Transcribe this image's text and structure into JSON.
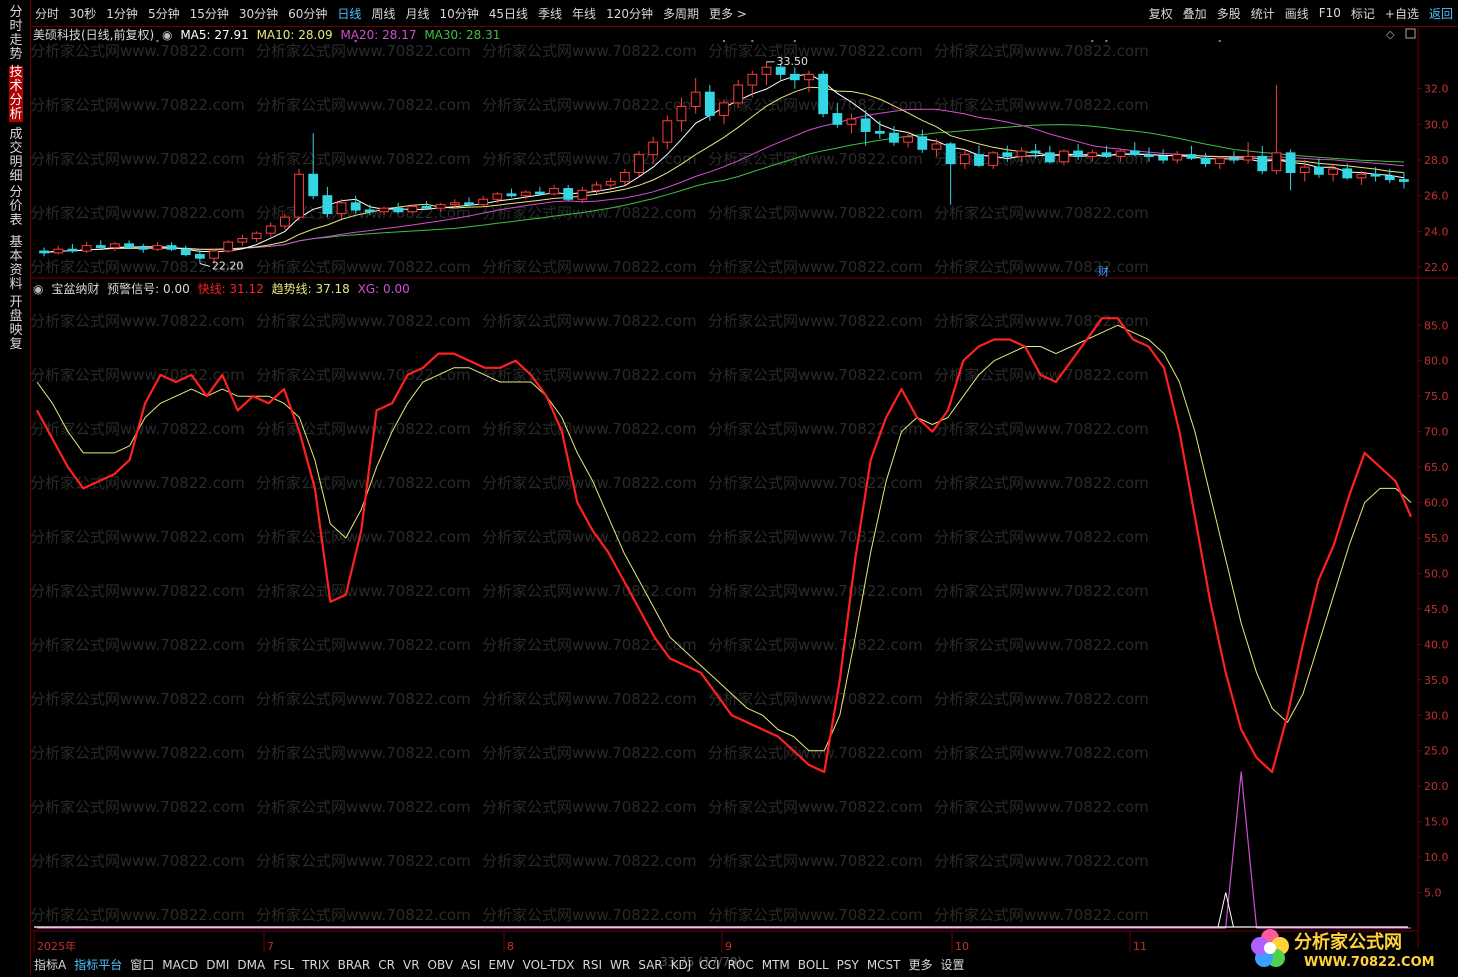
{
  "app": {
    "topbar_periods": [
      "分时",
      "30秒",
      "1分钟",
      "5分钟",
      "15分钟",
      "30分钟",
      "60分钟",
      "日线",
      "周线",
      "月线",
      "10分钟",
      "45日线",
      "季线",
      "年线",
      "120分钟",
      "多周期",
      "更多 >"
    ],
    "topbar_active": "日线",
    "topbar_right": [
      "复权",
      "叠加",
      "多股",
      "统计",
      "画线",
      "F10",
      "标记",
      "+自选",
      "返回"
    ],
    "sidebar": [
      "分时走势",
      "技术分析",
      "成交明细",
      "分价表",
      "基本资料",
      "开盘映复"
    ],
    "sidebar_active": "技术分析"
  },
  "main_chart": {
    "stock_title": "美硕科技(日线,前复权)",
    "ma5_label": "MA5: 27.91",
    "ma10_label": "MA10: 28.09",
    "ma20_label": "MA20: 28.17",
    "ma30_label": "MA30: 28.31",
    "high_label": "33.50",
    "low_label": "22.20",
    "cai_marker": "财",
    "price_axis": [
      "32.0",
      "30.0",
      "28.0",
      "26.0",
      "24.0",
      "22.0"
    ]
  },
  "indicator": {
    "name": "宝盆纳财",
    "signal_label": "预警信号: 0.00",
    "fast_label": "快线: 31.12",
    "trend_label": "趋势线: 37.18",
    "xg_label": "XG: 0.00",
    "axis": [
      "85.0",
      "80.0",
      "75.0",
      "70.0",
      "65.0",
      "60.0",
      "55.0",
      "50.0",
      "45.0",
      "40.0",
      "35.0",
      "30.0",
      "25.0",
      "20.0",
      "15.0",
      "10.0",
      "5.0"
    ]
  },
  "date_axis": [
    "2025年",
    "7",
    "8",
    "9",
    "10",
    "11"
  ],
  "watermark": "分析家公式网www.70822.com",
  "cursor_label": "33.75 (17/79)",
  "bottom_tabs": [
    "指标A",
    "指标平台",
    "窗口",
    "MACD",
    "DMI",
    "DMA",
    "FSL",
    "TRIX",
    "BRAR",
    "CR",
    "VR",
    "OBV",
    "ASI",
    "EMV",
    "VOL-TDX",
    "RSI",
    "WR",
    "SAR",
    "KDJ",
    "CCI",
    "ROC",
    "MTM",
    "BOLL",
    "PSY",
    "MCST",
    "更多",
    "设置"
  ],
  "bottom_active": "指标平台",
  "logo": {
    "line1": "分析家公式网",
    "line2": "WWW.70822.COM"
  },
  "colors": {
    "up": "#ff3b3b",
    "down": "#35d6e4",
    "fast": "#ff2020",
    "trend": "#e8e880",
    "ma5": "#ffffff",
    "ma10": "#e8e880",
    "ma20": "#d050d0",
    "ma30": "#40c040",
    "border": "#6e0000"
  },
  "chart_data": [
    {
      "type": "candlestick",
      "title": "美硕科技(日线,前复权)",
      "ylim": [
        21.5,
        34.5
      ],
      "candles_ohlc": [
        [
          22.9,
          23.1,
          22.6,
          22.8
        ],
        [
          22.8,
          23.2,
          22.7,
          23.0
        ],
        [
          23.0,
          23.3,
          22.8,
          22.9
        ],
        [
          22.9,
          23.4,
          22.8,
          23.2
        ],
        [
          23.2,
          23.5,
          23.0,
          23.1
        ],
        [
          23.1,
          23.4,
          22.9,
          23.3
        ],
        [
          23.3,
          23.5,
          23.0,
          23.1
        ],
        [
          23.1,
          23.3,
          22.8,
          23.0
        ],
        [
          23.0,
          23.4,
          22.9,
          23.2
        ],
        [
          23.2,
          23.4,
          22.9,
          23.0
        ],
        [
          23.0,
          23.2,
          22.6,
          22.7
        ],
        [
          22.7,
          23.0,
          22.2,
          22.5
        ],
        [
          22.5,
          23.0,
          22.2,
          22.9
        ],
        [
          22.9,
          23.5,
          22.8,
          23.4
        ],
        [
          23.4,
          23.8,
          23.2,
          23.6
        ],
        [
          23.6,
          24.0,
          23.4,
          23.9
        ],
        [
          23.9,
          24.5,
          23.7,
          24.3
        ],
        [
          24.3,
          25.0,
          24.1,
          24.8
        ],
        [
          24.8,
          27.5,
          24.6,
          27.2
        ],
        [
          27.2,
          29.5,
          25.8,
          26.0
        ],
        [
          26.0,
          26.5,
          24.8,
          25.0
        ],
        [
          25.0,
          25.8,
          24.7,
          25.6
        ],
        [
          25.6,
          26.0,
          25.0,
          25.2
        ],
        [
          25.2,
          25.5,
          24.9,
          25.1
        ],
        [
          25.1,
          25.4,
          24.9,
          25.3
        ],
        [
          25.3,
          25.6,
          25.0,
          25.1
        ],
        [
          25.1,
          25.5,
          25.0,
          25.4
        ],
        [
          25.4,
          25.7,
          25.2,
          25.3
        ],
        [
          25.3,
          25.6,
          25.1,
          25.5
        ],
        [
          25.5,
          25.8,
          25.3,
          25.6
        ],
        [
          25.6,
          25.9,
          25.4,
          25.5
        ],
        [
          25.5,
          26.0,
          25.4,
          25.8
        ],
        [
          25.8,
          26.2,
          25.6,
          26.1
        ],
        [
          26.1,
          26.4,
          25.9,
          26.0
        ],
        [
          26.0,
          26.3,
          25.8,
          26.2
        ],
        [
          26.2,
          26.5,
          26.0,
          26.1
        ],
        [
          26.1,
          26.6,
          26.0,
          26.4
        ],
        [
          26.4,
          26.6,
          25.7,
          25.8
        ],
        [
          25.8,
          26.5,
          25.6,
          26.3
        ],
        [
          26.3,
          26.8,
          26.1,
          26.6
        ],
        [
          26.6,
          27.0,
          26.3,
          26.8
        ],
        [
          26.8,
          27.5,
          26.6,
          27.3
        ],
        [
          27.3,
          28.5,
          27.1,
          28.3
        ],
        [
          28.3,
          29.3,
          27.8,
          29.0
        ],
        [
          29.0,
          30.5,
          28.6,
          30.2
        ],
        [
          30.2,
          31.5,
          29.6,
          31.0
        ],
        [
          31.0,
          32.6,
          30.6,
          31.8
        ],
        [
          31.8,
          32.2,
          30.2,
          30.5
        ],
        [
          30.5,
          31.4,
          30.0,
          31.2
        ],
        [
          31.2,
          32.5,
          30.9,
          32.2
        ],
        [
          32.2,
          33.0,
          31.5,
          32.8
        ],
        [
          32.8,
          33.5,
          32.2,
          33.2
        ],
        [
          33.2,
          33.4,
          32.5,
          32.8
        ],
        [
          32.8,
          33.2,
          32.0,
          32.5
        ],
        [
          32.5,
          33.0,
          31.8,
          32.8
        ],
        [
          32.8,
          33.0,
          30.4,
          30.6
        ],
        [
          30.6,
          31.2,
          29.8,
          30.0
        ],
        [
          30.0,
          30.6,
          29.5,
          30.3
        ],
        [
          30.3,
          30.8,
          28.8,
          29.6
        ],
        [
          29.6,
          30.2,
          29.2,
          29.5
        ],
        [
          29.5,
          29.9,
          28.8,
          29.0
        ],
        [
          29.0,
          29.6,
          28.7,
          29.3
        ],
        [
          29.3,
          29.7,
          28.4,
          28.6
        ],
        [
          28.6,
          29.2,
          28.2,
          28.9
        ],
        [
          28.9,
          29.0,
          25.5,
          27.8
        ],
        [
          27.8,
          28.6,
          27.5,
          28.3
        ],
        [
          28.3,
          28.8,
          27.6,
          27.7
        ],
        [
          27.7,
          28.5,
          27.5,
          28.4
        ],
        [
          28.4,
          28.8,
          27.9,
          28.2
        ],
        [
          28.2,
          28.7,
          27.9,
          28.5
        ],
        [
          28.5,
          28.9,
          28.1,
          28.4
        ],
        [
          28.4,
          28.8,
          27.8,
          27.9
        ],
        [
          27.9,
          28.6,
          27.7,
          28.5
        ],
        [
          28.5,
          28.9,
          28.0,
          28.2
        ],
        [
          28.2,
          28.6,
          27.9,
          28.4
        ],
        [
          28.4,
          28.8,
          28.1,
          28.2
        ],
        [
          28.2,
          28.6,
          27.9,
          28.5
        ],
        [
          28.5,
          29.0,
          28.2,
          28.3
        ],
        [
          28.3,
          28.7,
          27.9,
          28.2
        ],
        [
          28.2,
          28.6,
          27.8,
          28.0
        ],
        [
          28.0,
          28.5,
          27.8,
          28.3
        ],
        [
          28.3,
          28.8,
          28.0,
          28.1
        ],
        [
          28.1,
          28.4,
          27.6,
          27.8
        ],
        [
          27.8,
          28.2,
          27.5,
          28.1
        ],
        [
          28.1,
          28.5,
          27.8,
          28.0
        ],
        [
          28.0,
          29.0,
          27.8,
          28.2
        ],
        [
          28.2,
          28.8,
          27.2,
          27.4
        ],
        [
          27.4,
          32.2,
          27.2,
          28.4
        ],
        [
          28.4,
          28.6,
          26.3,
          27.3
        ],
        [
          27.3,
          28.0,
          26.8,
          27.6
        ],
        [
          27.6,
          28.1,
          27.0,
          27.2
        ],
        [
          27.2,
          27.8,
          26.8,
          27.5
        ],
        [
          27.5,
          27.8,
          26.9,
          27.0
        ],
        [
          27.0,
          27.4,
          26.6,
          27.2
        ],
        [
          27.2,
          27.6,
          26.8,
          27.1
        ],
        [
          27.1,
          27.5,
          26.7,
          26.9
        ],
        [
          26.9,
          27.3,
          26.4,
          26.8
        ]
      ],
      "ma_series": [
        {
          "name": "MA5",
          "last": 27.91
        },
        {
          "name": "MA10",
          "last": 28.09
        },
        {
          "name": "MA20",
          "last": 28.17
        },
        {
          "name": "MA30",
          "last": 28.31
        }
      ]
    },
    {
      "type": "line",
      "title": "宝盆纳财",
      "ylim": [
        0,
        88
      ],
      "x_count": 90,
      "series": [
        {
          "name": "快线",
          "values": [
            73,
            69,
            65,
            62,
            63,
            64,
            66,
            74,
            78,
            77,
            78,
            75,
            78,
            73,
            75,
            74,
            76,
            70,
            62,
            46,
            47,
            56,
            73,
            74,
            78,
            79,
            81,
            81,
            80,
            79,
            79,
            80,
            78,
            75,
            70,
            60,
            56,
            53,
            49,
            45,
            41,
            38,
            37,
            36,
            33,
            30,
            29,
            28,
            27,
            25,
            23,
            22,
            35,
            52,
            66,
            72,
            76,
            72,
            70,
            73,
            80,
            82,
            83,
            83,
            82,
            78,
            77,
            80,
            83,
            86,
            86,
            83,
            82,
            79,
            70,
            58,
            46,
            36,
            28,
            24,
            22,
            30,
            40,
            49,
            54,
            61,
            67,
            65,
            63,
            58
          ]
        },
        {
          "name": "趋势线",
          "values": [
            77,
            74,
            70,
            67,
            67,
            67,
            68,
            72,
            74,
            75,
            76,
            75,
            76,
            75,
            75,
            75,
            74,
            72,
            66,
            57,
            55,
            59,
            65,
            70,
            74,
            77,
            78,
            79,
            79,
            78,
            77,
            77,
            77,
            75,
            72,
            67,
            63,
            58,
            53,
            49,
            45,
            41,
            39,
            37,
            35,
            33,
            31,
            30,
            28,
            27,
            25,
            25,
            30,
            41,
            53,
            63,
            70,
            72,
            71,
            72,
            75,
            78,
            80,
            81,
            82,
            82,
            81,
            82,
            83,
            84,
            85,
            84,
            83,
            81,
            77,
            70,
            61,
            52,
            43,
            36,
            31,
            29,
            33,
            40,
            47,
            54,
            60,
            62,
            62,
            60
          ]
        },
        {
          "name": "XG",
          "values": [
            0,
            0,
            0,
            0,
            0,
            0,
            0,
            0,
            0,
            0,
            0,
            0,
            0,
            0,
            0,
            0,
            0,
            0,
            0,
            0,
            0,
            0,
            0,
            0,
            0,
            0,
            0,
            0,
            0,
            0,
            0,
            0,
            0,
            0,
            0,
            0,
            0,
            0,
            0,
            0,
            0,
            0,
            0,
            0,
            0,
            0,
            0,
            0,
            0,
            0,
            0,
            0,
            0,
            0,
            0,
            0,
            0,
            0,
            0,
            0,
            0,
            0,
            0,
            0,
            0,
            0,
            0,
            0,
            0,
            0,
            0,
            0,
            0,
            0,
            0,
            0,
            0,
            0,
            22,
            0,
            0,
            0,
            0,
            0,
            0,
            0,
            0,
            0,
            0,
            0
          ]
        }
      ],
      "fast_last": 31.12,
      "trend_last": 37.18,
      "xg_last": 0.0
    }
  ]
}
